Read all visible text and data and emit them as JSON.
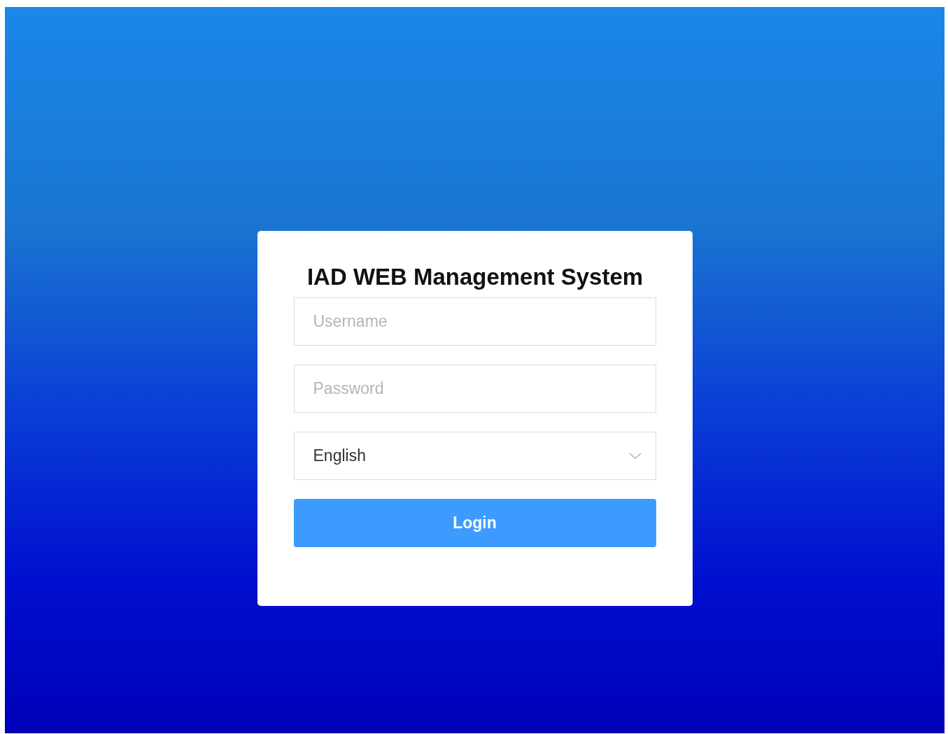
{
  "login_form": {
    "title": "IAD WEB Management System",
    "username": {
      "placeholder": "Username"
    },
    "password": {
      "placeholder": "Password"
    },
    "language": {
      "value": "English"
    },
    "button": "Login"
  }
}
